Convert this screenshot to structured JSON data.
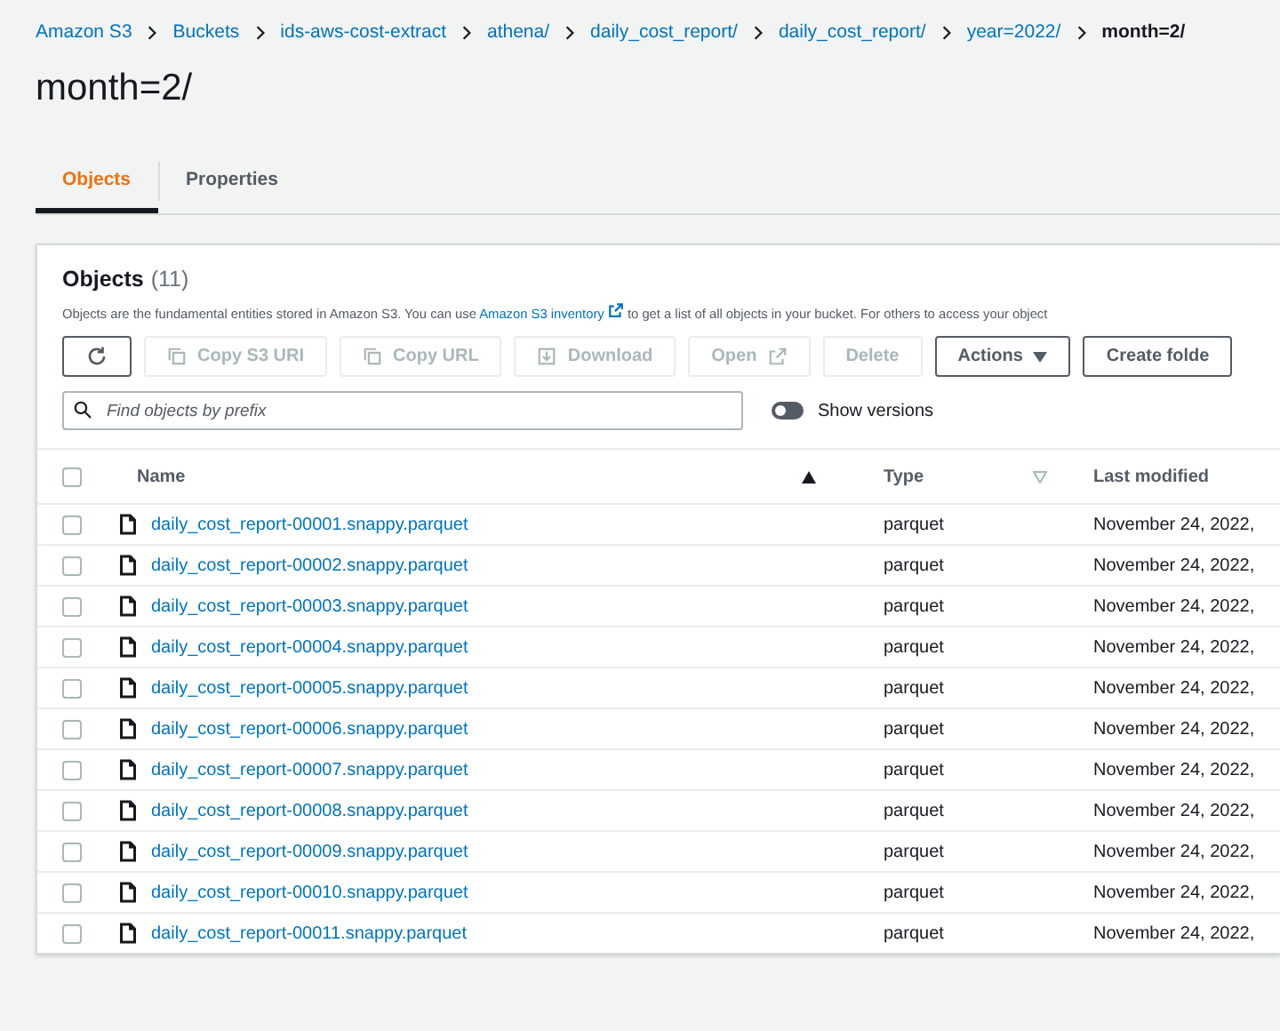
{
  "breadcrumbs": [
    "Amazon S3",
    "Buckets",
    "ids-aws-cost-extract",
    "athena/",
    "daily_cost_report/",
    "daily_cost_report/",
    "year=2022/",
    "month=2/"
  ],
  "title": "month=2/",
  "tabs": [
    {
      "label": "Objects",
      "selected": true
    },
    {
      "label": "Properties",
      "selected": false
    }
  ],
  "panel": {
    "heading": "Objects",
    "count": "(11)",
    "description": {
      "before": "Objects are the fundamental entities stored in Amazon S3. You can use ",
      "link": "Amazon S3 inventory",
      "after": " to get a list of all objects in your bucket. For others to access your object"
    },
    "buttons": [
      {
        "kind": "refresh",
        "disabled": false
      },
      {
        "kind": "copy",
        "label": "Copy S3 URI",
        "disabled": true
      },
      {
        "kind": "copy",
        "label": "Copy URL",
        "disabled": true
      },
      {
        "kind": "download",
        "label": "Download",
        "disabled": true
      },
      {
        "kind": "open",
        "label": "Open",
        "disabled": true
      },
      {
        "kind": "plain",
        "label": "Delete",
        "disabled": true
      },
      {
        "kind": "dropdown",
        "label": "Actions",
        "disabled": false
      },
      {
        "kind": "plain",
        "label": "Create folde",
        "disabled": false
      }
    ],
    "search": {
      "placeholder": "Find objects by prefix"
    },
    "show_versions": {
      "label": "Show versions",
      "on": false
    }
  },
  "table": {
    "select_all": {
      "checked": false
    },
    "columns": [
      {
        "label": "Name",
        "sorted": true
      },
      {
        "label": "Type",
        "sorted": false
      },
      {
        "label": "Last modified",
        "sorted": false
      }
    ],
    "rows": [
      {
        "name": "daily_cost_report-00001.snappy.parquet",
        "type": "parquet",
        "modified": "November 24, 2022,",
        "checked": false
      },
      {
        "name": "daily_cost_report-00002.snappy.parquet",
        "type": "parquet",
        "modified": "November 24, 2022,",
        "checked": false
      },
      {
        "name": "daily_cost_report-00003.snappy.parquet",
        "type": "parquet",
        "modified": "November 24, 2022,",
        "checked": false
      },
      {
        "name": "daily_cost_report-00004.snappy.parquet",
        "type": "parquet",
        "modified": "November 24, 2022,",
        "checked": false
      },
      {
        "name": "daily_cost_report-00005.snappy.parquet",
        "type": "parquet",
        "modified": "November 24, 2022,",
        "checked": false
      },
      {
        "name": "daily_cost_report-00006.snappy.parquet",
        "type": "parquet",
        "modified": "November 24, 2022,",
        "checked": false
      },
      {
        "name": "daily_cost_report-00007.snappy.parquet",
        "type": "parquet",
        "modified": "November 24, 2022,",
        "checked": false
      },
      {
        "name": "daily_cost_report-00008.snappy.parquet",
        "type": "parquet",
        "modified": "November 24, 2022,",
        "checked": false
      },
      {
        "name": "daily_cost_report-00009.snappy.parquet",
        "type": "parquet",
        "modified": "November 24, 2022,",
        "checked": false
      },
      {
        "name": "daily_cost_report-00010.snappy.parquet",
        "type": "parquet",
        "modified": "November 24, 2022,",
        "checked": false
      },
      {
        "name": "daily_cost_report-00011.snappy.parquet",
        "type": "parquet",
        "modified": "November 24, 2022,",
        "checked": false
      }
    ]
  }
}
